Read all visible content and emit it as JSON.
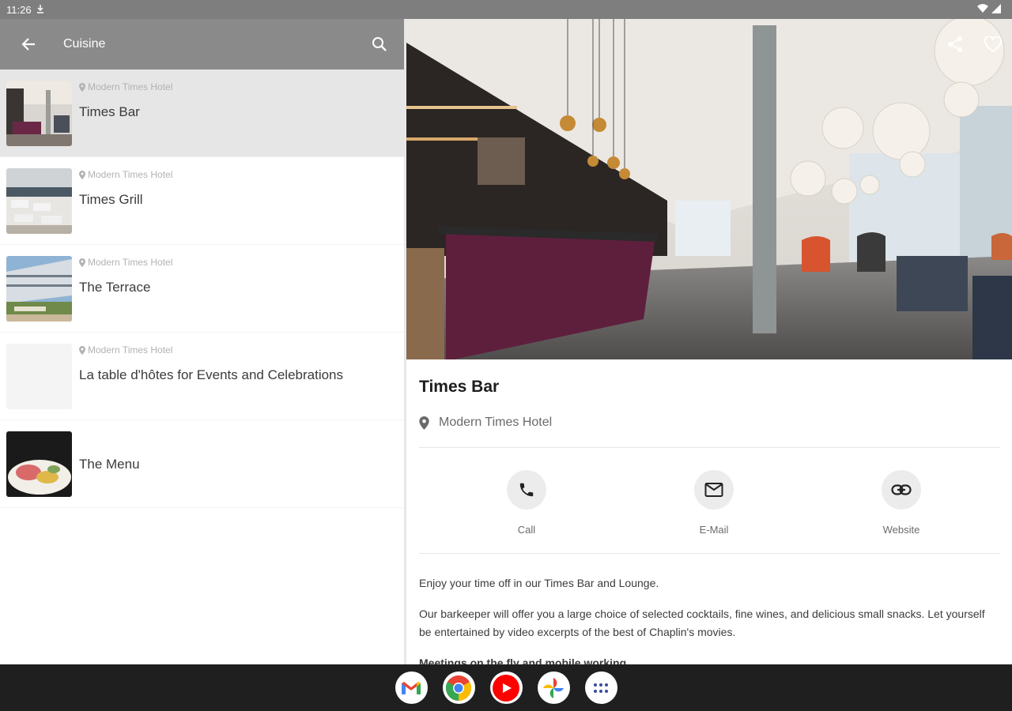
{
  "status_bar": {
    "time": "11:26"
  },
  "app_bar": {
    "title": "Cuisine"
  },
  "list": [
    {
      "location": "Modern Times Hotel",
      "title": "Times Bar",
      "selected": true
    },
    {
      "location": "Modern Times Hotel",
      "title": "Times Grill"
    },
    {
      "location": "Modern Times Hotel",
      "title": "The Terrace"
    },
    {
      "location": "Modern Times Hotel",
      "title": "La table d'hôtes for Events and Celebrations"
    },
    {
      "location": "",
      "title": "The Menu"
    }
  ],
  "detail": {
    "title": "Times Bar",
    "location": "Modern Times Hotel",
    "actions": {
      "call": "Call",
      "email": "E-Mail",
      "website": "Website"
    },
    "paragraphs": [
      "Enjoy your time off in our Times Bar and Lounge.",
      "Our barkeeper will offer you a large choice of selected cocktails, fine wines, and delicious small snacks. Let yourself be entertained by video excerpts of the best of Chaplin's movies.",
      "Meetings on the fly and mobile working"
    ]
  },
  "dock": [
    "gmail-icon",
    "chrome-icon",
    "youtube-icon",
    "photos-icon",
    "app-drawer-icon"
  ],
  "colors": {
    "app_bar": "#8a8a8a",
    "selected_row": "#e6e6e6",
    "nav_bar": "#1f1f1f"
  }
}
